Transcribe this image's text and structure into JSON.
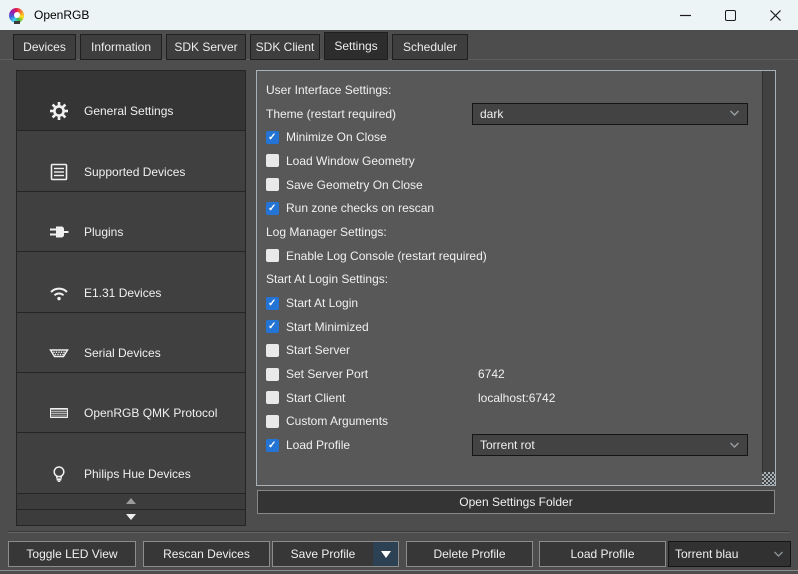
{
  "titlebar": {
    "title": "OpenRGB",
    "app_icon": "rgb-lightbulb-icon",
    "controls": [
      "minimize",
      "maximize",
      "close"
    ]
  },
  "tabs": {
    "active": "Settings",
    "items": [
      {
        "label": "Devices",
        "active": false
      },
      {
        "label": "Information",
        "active": false
      },
      {
        "label": "SDK Server",
        "active": false
      },
      {
        "label": "SDK Client",
        "active": false
      },
      {
        "label": "Settings",
        "active": true
      },
      {
        "label": "Scheduler",
        "active": false
      }
    ]
  },
  "sidebar": {
    "items": [
      {
        "label": "General Settings",
        "icon": "gear-icon",
        "selected": true
      },
      {
        "label": "Supported Devices",
        "icon": "list-icon",
        "selected": false
      },
      {
        "label": "Plugins",
        "icon": "plug-icon",
        "selected": false
      },
      {
        "label": "E1.31 Devices",
        "icon": "wifi-icon",
        "selected": false
      },
      {
        "label": "Serial Devices",
        "icon": "serial-port-icon",
        "selected": false
      },
      {
        "label": "OpenRGB QMK Protocol",
        "icon": "keyboard-icon",
        "selected": false
      },
      {
        "label": "Philips Hue Devices",
        "icon": "lightbulb-icon",
        "selected": false
      }
    ],
    "scroll_up_enabled": false,
    "scroll_down_enabled": true
  },
  "settings_panel": {
    "rows": [
      {
        "type": "section",
        "label": "User Interface Settings:"
      },
      {
        "type": "dropdown",
        "label": "Theme (restart required)",
        "value": "dark"
      },
      {
        "type": "checkbox",
        "label": "Minimize On Close",
        "checked": true
      },
      {
        "type": "checkbox",
        "label": "Load Window Geometry",
        "checked": false
      },
      {
        "type": "checkbox",
        "label": "Save Geometry On Close",
        "checked": false
      },
      {
        "type": "checkbox",
        "label": "Run zone checks on rescan",
        "checked": true
      },
      {
        "type": "section",
        "label": "Log Manager Settings:"
      },
      {
        "type": "checkbox",
        "label": "Enable Log Console (restart required)",
        "checked": false
      },
      {
        "type": "section",
        "label": "Start At Login Settings:"
      },
      {
        "type": "checkbox",
        "label": "Start At Login",
        "checked": true
      },
      {
        "type": "checkbox",
        "label": "Start Minimized",
        "checked": true
      },
      {
        "type": "checkbox",
        "label": "Start Server",
        "checked": false
      },
      {
        "type": "checkbox",
        "label": "Set Server Port",
        "checked": false,
        "value": "6742"
      },
      {
        "type": "checkbox",
        "label": "Start Client",
        "checked": false,
        "value": "localhost:6742"
      },
      {
        "type": "checkbox",
        "label": "Custom Arguments",
        "checked": false
      },
      {
        "type": "checkbox",
        "label": "Load Profile",
        "checked": true,
        "dropdown_value": "Torrent rot"
      }
    ],
    "open_settings_folder": "Open Settings Folder"
  },
  "bottom_bar": {
    "toggle_led_view": "Toggle LED View",
    "rescan_devices": "Rescan Devices",
    "save_profile": "Save Profile",
    "delete_profile": "Delete Profile",
    "load_profile": "Load Profile",
    "profile_combo_value": "Torrent blau"
  },
  "colors": {
    "titlebar_bg": "#ecf4f5",
    "window_bg": "#4d4d4d",
    "panel_bg": "#585858",
    "panel_border": "#a9b1b8",
    "tab_active_bg": "#2d2d2d",
    "checkbox_checked": "#2374d4",
    "save_split_arrow_bg": "#2c4153",
    "text": "#f0f0f0"
  }
}
